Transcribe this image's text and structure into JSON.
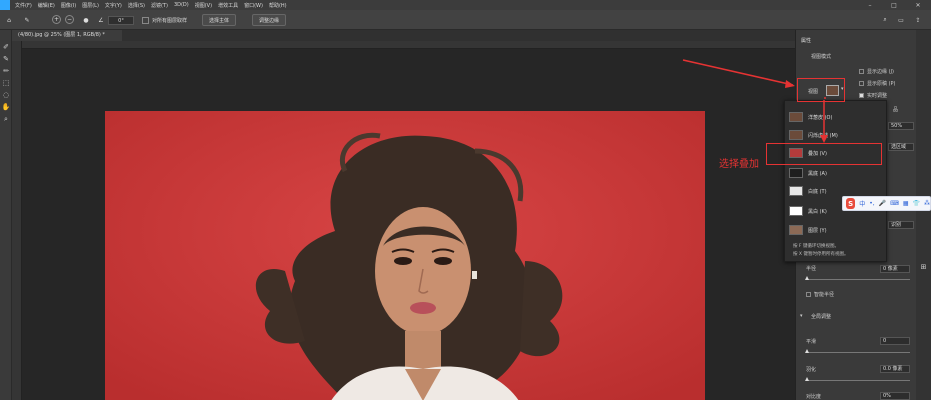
{
  "menubar": {
    "items": [
      "文件(F)",
      "编辑(E)",
      "图像(I)",
      "图层(L)",
      "文字(Y)",
      "选择(S)",
      "滤镜(T)",
      "3D(D)",
      "视图(V)",
      "增效工具",
      "窗口(W)",
      "帮助(H)"
    ],
    "minimize": "–",
    "maximize": "□",
    "close": "✕"
  },
  "options": {
    "size_field": "0°",
    "all_layers_label": "对所有图层取样",
    "select_subject_label": "选择主体",
    "select_mask_label": "调整边缘"
  },
  "document": {
    "tab_title": "(4/80).jpg @ 25% (图层 1, RGB/8) *"
  },
  "properties": {
    "tab": "属性",
    "section": "视图模式",
    "view_label": "视图",
    "show_edge": "显示边缘 (J)",
    "show_original": "显示原稿 (P)",
    "realtime": "实时调整",
    "partial_label": "品",
    "percent_value": "50%",
    "partial_right": "选区域",
    "right_button": "识别",
    "radius_label": "半径",
    "radius_value": "0 像素",
    "smart_radius": "智能半径",
    "global_section": "全局调整",
    "smooth_label": "平滑",
    "smooth_value": "0",
    "feather_label": "羽化",
    "feather_value": "0.0 像素",
    "contrast_label": "对比度",
    "contrast_value": "0%"
  },
  "view_dropdown": {
    "items": [
      {
        "label": "洋葱皮 (O)"
      },
      {
        "label": "闪烁虚线 (M)"
      },
      {
        "label": "叠加 (V)"
      },
      {
        "label": "黑底 (A)"
      },
      {
        "label": "白底 (T)"
      },
      {
        "label": "黑白 (K)"
      },
      {
        "label": "图层 (Y)"
      }
    ],
    "note_1": "按 F 键循环切换视图。",
    "note_2": "按 X 键暂时停用所有视图。"
  },
  "annotation": {
    "text": "选择叠加"
  },
  "ime": {
    "logo": "S",
    "lang": "中"
  },
  "colors": {
    "annotation_red": "#e53333",
    "backdrop_red": "#cf3a3a",
    "panel_bg": "#3a3a3a"
  }
}
